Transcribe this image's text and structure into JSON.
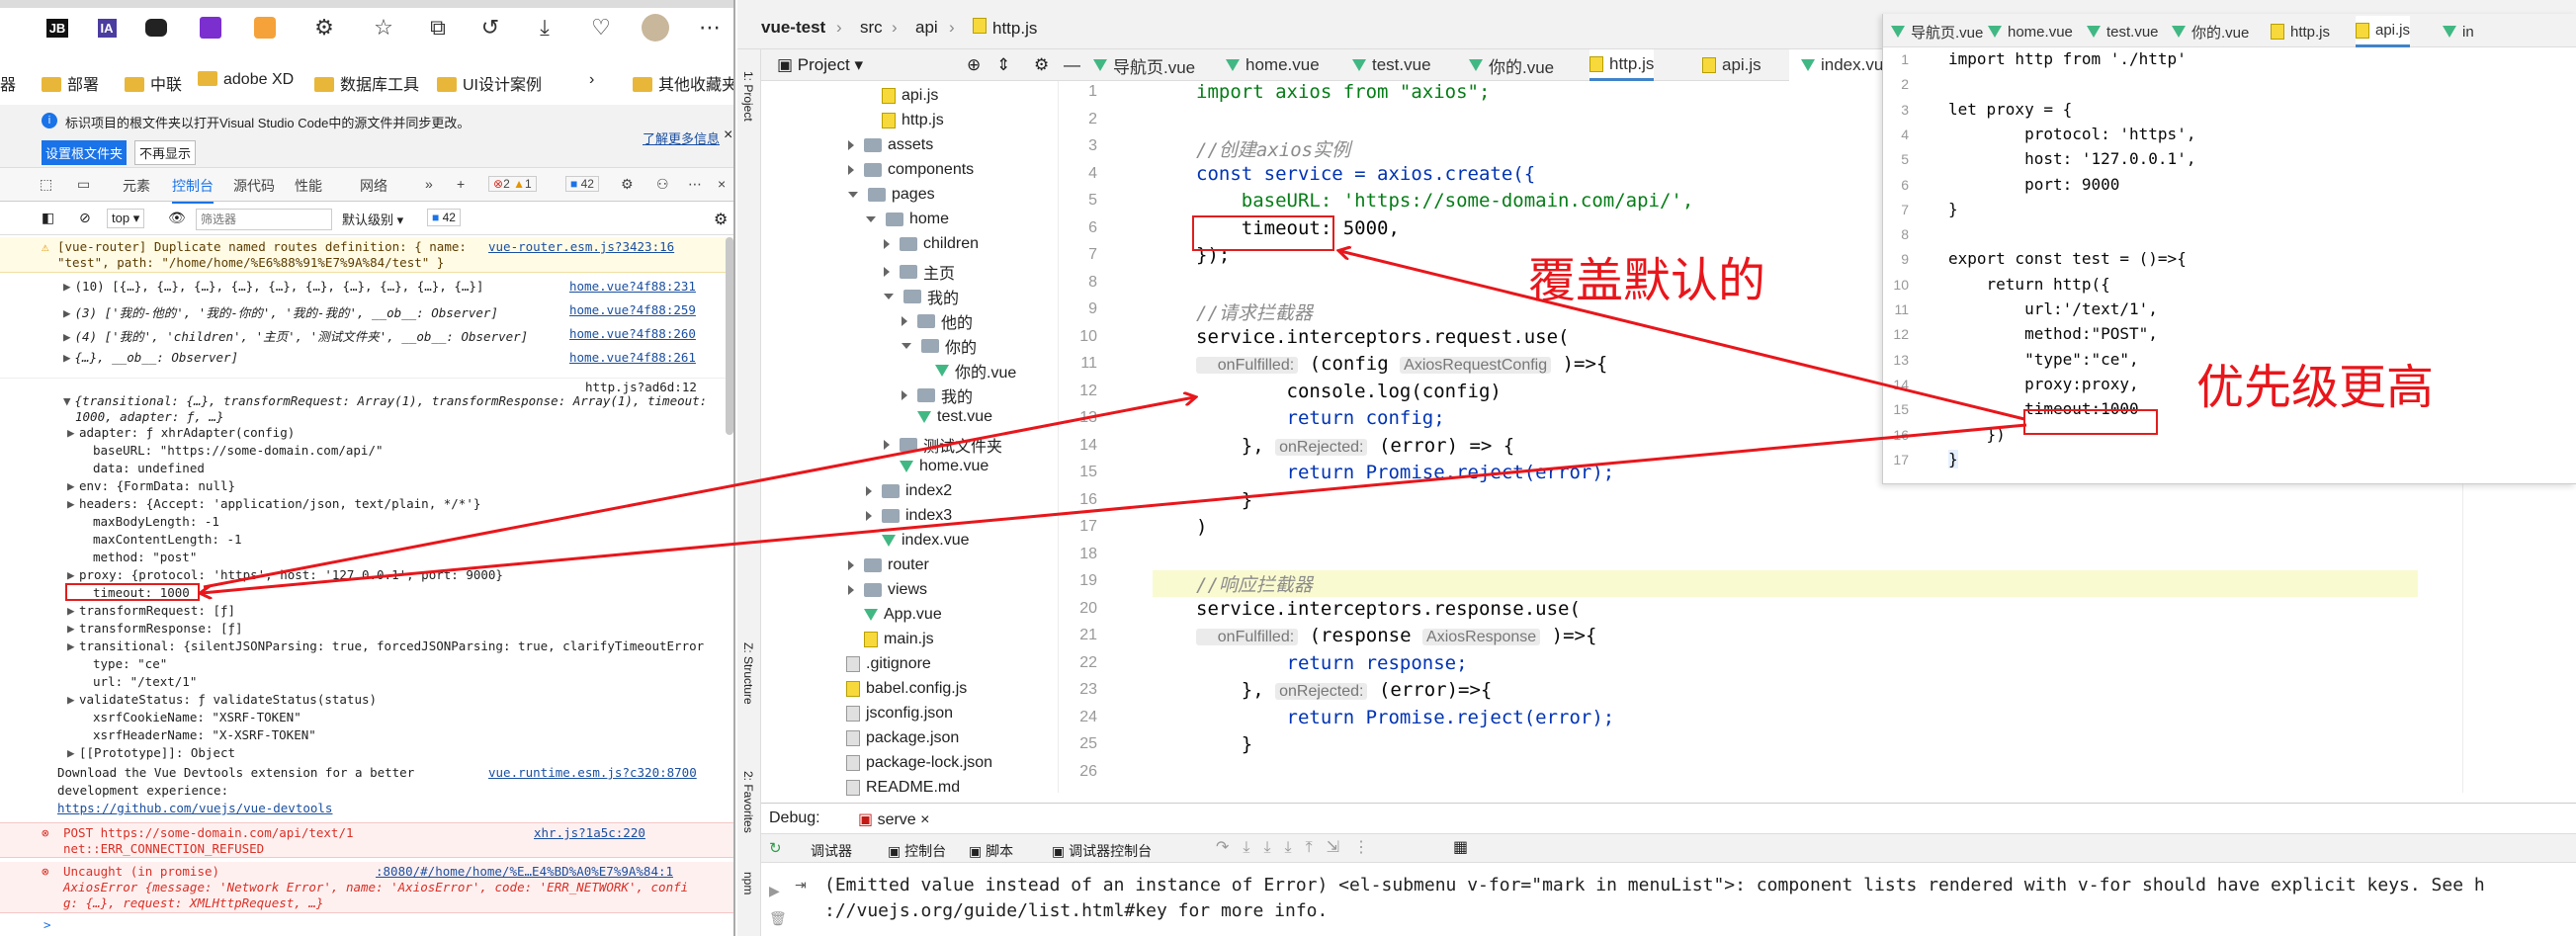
{
  "browser": {
    "bookmarks": [
      "器",
      "部署",
      "中联",
      "adobe XD",
      "数据库工具",
      "UI设计案例",
      "其他收藏夹"
    ],
    "info": {
      "text": "标识项目的根文件夹以打开Visual Studio Code中的源文件并同步更改。",
      "link": "了解更多信息",
      "btn_primary": "设置根文件夹",
      "btn_secondary": "不再显示"
    },
    "devtools": {
      "tabs": [
        "元素",
        "控制台",
        "源代码",
        "性能",
        "网络"
      ],
      "errors": "2",
      "warnings": "1",
      "messages": "42",
      "context": "top",
      "filter_placeholder": "筛选器",
      "level": "默认级别",
      "issues": "42"
    },
    "console": {
      "warn_text": "[vue-router] Duplicate named routes definition: { name:",
      "warn_src": "vue-router.esm.js?3423:16",
      "warn_text2": "\"test\", path: \"/home/home/%E6%88%91%E7%9A%84/test\" }",
      "logs": [
        {
          "text": "(10) [{…}, {…}, {…}, {…}, {…}, {…}, {…}, {…}, {…}, {…}]",
          "src": "home.vue?4f88:231"
        },
        {
          "text": "(3) ['我的-他的', '我的-你的', '我的-我的', __ob__: Observer]",
          "src": "home.vue?4f88:259"
        },
        {
          "text": "(4) ['我的', 'children', '主页', '测试文件夹', __ob__: Observer]",
          "src": "home.vue?4f88:260"
        },
        {
          "text": "{…}, __ob__: Observer]",
          "src": "home.vue?4f88:261"
        }
      ],
      "http_src": "http.js?ad6d:12",
      "obj_header": "{transitional: {…}, transformRequest: Array(1), transformResponse: Array(1), timeout:",
      "obj_header2": "1000, adapter: ƒ, …}",
      "props": [
        "adapter: ƒ xhrAdapter(config)",
        "baseURL: \"https://some-domain.com/api/\"",
        "data: undefined",
        "env: {FormData: null}",
        "headers: {Accept: 'application/json, text/plain, */*'}",
        "maxBodyLength: -1",
        "maxContentLength: -1",
        "method: \"post\"",
        "proxy: {protocol: 'https', host: '127.0.0.1', port: 9000}",
        "timeout: 1000",
        "transformRequest: [ƒ]",
        "transformResponse: [ƒ]",
        "transitional: {silentJSONParsing: true, forcedJSONParsing: true, clarifyTimeoutError",
        "type: \"ce\"",
        "url: \"/text/1\"",
        "validateStatus: ƒ validateStatus(status)",
        "xsrfCookieName: \"XSRF-TOKEN\"",
        "xsrfHeaderName: \"X-XSRF-TOKEN\"",
        "[[Prototype]]: Object"
      ],
      "devtools_msg": [
        "Download the Vue Devtools extension for a better",
        "development experience:",
        "https://github.com/vuejs/vue-devtools"
      ],
      "devtools_src": "vue.runtime.esm.js?c320:8700",
      "err1": [
        "POST https://some-domain.com/api/text/1",
        "net::ERR_CONNECTION_REFUSED"
      ],
      "err1_src": "xhr.js?1a5c:220",
      "err2": [
        "Uncaught (in promise)",
        "AxiosError {message: 'Network Error', name: 'AxiosError', code: 'ERR_NETWORK', confi",
        "g: {…}, request: XMLHttpRequest, …}"
      ],
      "err2_src": ":8080/#/home/home/%E…E4%BD%A0%E7%9A%84:1",
      "prompt": ">"
    }
  },
  "ide": {
    "breadcrumb": [
      "vue-test",
      "src",
      "api",
      "http.js"
    ],
    "project_label": "Project",
    "tabs": [
      "导航页.vue",
      "home.vue",
      "test.vue",
      "你的.vue",
      "http.js",
      "api.js",
      "index.vu"
    ],
    "tree": [
      "api.js",
      "http.js",
      "assets",
      "components",
      "pages",
      "home",
      "children",
      "主页",
      "我的",
      "他的",
      "你的",
      "你的.vue",
      "我的",
      "test.vue",
      "测试文件夹",
      "home.vue",
      "index2",
      "index3",
      "index.vue",
      "router",
      "views",
      "App.vue",
      "main.js",
      ".gitignore",
      "babel.config.js",
      "jsconfig.json",
      "package.json",
      "package-lock.json",
      "README.md"
    ],
    "side_labels": [
      "1: Project",
      "Z: Structure",
      "2: Favorites",
      "npm"
    ],
    "code": [
      [
        "import axios from \"axios\";"
      ],
      [
        ""
      ],
      [
        "//创建axios实例"
      ],
      [
        "const service = axios.create({"
      ],
      [
        "    baseURL: 'https://some-domain.com/api/',"
      ],
      [
        "    timeout: 5000,"
      ],
      [
        "});"
      ],
      [
        ""
      ],
      [
        "//请求拦截器"
      ],
      [
        "service.interceptors.request.use("
      ],
      [
        "    onFulfilled:",
        "(config",
        "AxiosRequestConfig",
        ")=>{"
      ],
      [
        "        console.log(config)"
      ],
      [
        "        return config;"
      ],
      [
        "    },",
        "onRejected:",
        "(error) => {"
      ],
      [
        "        return Promise.reject(error);"
      ],
      [
        "    }"
      ],
      [
        ")"
      ],
      [
        ""
      ],
      [
        "//响应拦截器"
      ],
      [
        "service.interceptors.response.use("
      ],
      [
        "    onFulfilled:",
        "(response",
        "AxiosResponse",
        ")=>{"
      ],
      [
        "        return response;"
      ],
      [
        "    },",
        "onRejected:",
        "(error)=>{"
      ],
      [
        "        return Promise.reject(error);"
      ],
      [
        "    }"
      ]
    ],
    "popup_tabs": [
      "导航页.vue",
      "home.vue",
      "test.vue",
      "你的.vue",
      "http.js",
      "api.js",
      "in"
    ],
    "popup_code": [
      "import http from './http'",
      "",
      "let proxy = {",
      "        protocol: 'https',",
      "        host: '127.0.0.1',",
      "        port: 9000",
      "}",
      "",
      "export const test = ()=>{",
      "    return http({",
      "        url:'/text/1',",
      "        method:\"POST\",",
      "        \"type\":\"ce\",",
      "        proxy:proxy,",
      "        timeout:1000",
      "    })",
      "}"
    ],
    "debug": {
      "label": "Debug:",
      "config": "serve",
      "tabs": [
        "调试器",
        "控制台",
        "脚本",
        "调试器控制台"
      ],
      "output": [
        "(Emitted value instead of an instance of Error) <el-submenu v-for=\"mark in menuList\">: component lists rendered with v-for should have explicit keys. See h",
        "://vuejs.org/guide/list.html#key for more info."
      ]
    }
  },
  "annotations": {
    "override": "覆盖默认的",
    "priority": "优先级更高",
    "color": "#e8161b"
  }
}
